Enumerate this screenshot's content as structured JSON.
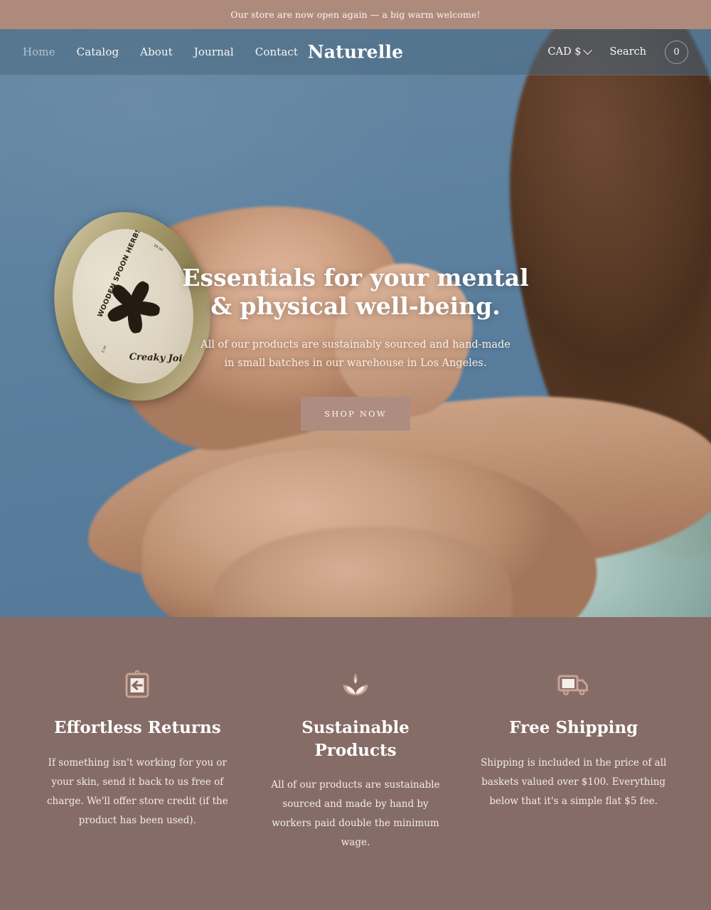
{
  "announcement": {
    "text": "Our store are now open again — a big warm welcome!"
  },
  "header": {
    "logo": "Naturelle",
    "nav": [
      {
        "label": "Home",
        "state": "active"
      },
      {
        "label": "Catalog",
        "state": "default"
      },
      {
        "label": "About",
        "state": "default"
      },
      {
        "label": "Journal",
        "state": "default"
      },
      {
        "label": "Contact",
        "state": "default"
      }
    ],
    "currency": "CAD $",
    "currency_icon": "chevron-down-icon",
    "search": "Search",
    "cart_count": "0"
  },
  "hero": {
    "title_line1": "Essentials for your mental",
    "title_line2": "& physical well-being.",
    "sub_line1": "All of our products are sustainably sourced and hand-made",
    "sub_line2": "in small batches in our warehouse in Los Angeles.",
    "cta": "SHOP NOW",
    "product_tin": {
      "brand": "WOODEN SPOON HERBS",
      "product": "Creaky Joint Salve",
      "size_metric": "59 ml",
      "size_imperial": "2 oz"
    }
  },
  "features": [
    {
      "icon": "returns-box-icon",
      "title": "Effortless Returns",
      "body": "If something isn't working for you or your skin, send it back to us free of charge. We'll offer store credit (if the product has been used)."
    },
    {
      "icon": "lotus-sprout-icon",
      "title": "Sustainable Products",
      "body": "All of our products are sustainable sourced and made by hand by workers paid double the minimum wage."
    },
    {
      "icon": "delivery-truck-icon",
      "title": "Free Shipping",
      "body": "Shipping is included in the price of all baskets valued over $100. Everything below that it's a simple flat $5 fee."
    }
  ],
  "colors": {
    "announcement_bg": "#ae8a7d",
    "hero_sky": "#5a7f9c",
    "features_bg": "#866c66",
    "cta_bg": "#af8c80",
    "text_light": "#ffffff"
  }
}
